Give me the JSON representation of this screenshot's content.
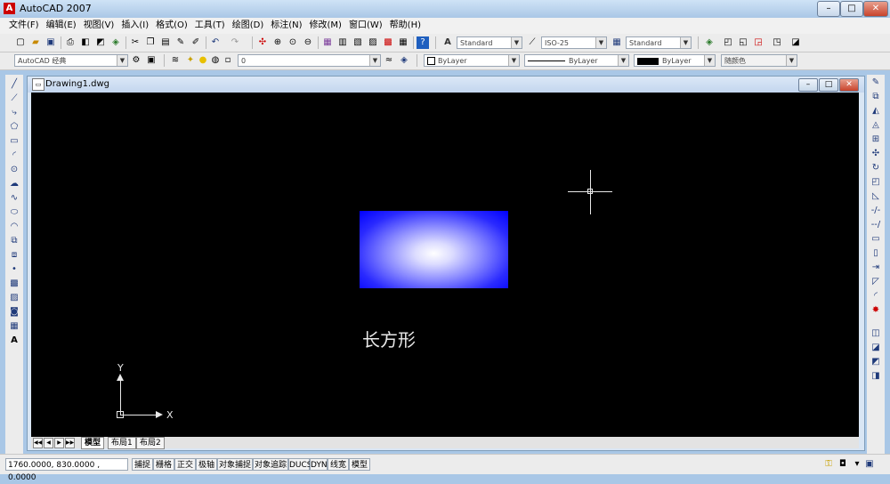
{
  "window": {
    "app_icon": "autocad-logo-icon",
    "title": "AutoCAD 2007",
    "min_label": "–",
    "max_label": "□",
    "close_label": "✕"
  },
  "menubar": [
    "文件(F)",
    "编辑(E)",
    "视图(V)",
    "插入(I)",
    "格式(O)",
    "工具(T)",
    "绘图(D)",
    "标注(N)",
    "修改(M)",
    "窗口(W)",
    "帮助(H)"
  ],
  "toolbar1": {
    "text_style": "Standard",
    "dim_style": "ISO-25",
    "table_style": "Standard"
  },
  "toolbar2": {
    "workspace": "AutoCAD 经典",
    "layer": "0",
    "color": "ByLayer",
    "linetype": "ByLayer",
    "lineweight": "ByLayer",
    "plot_style": "随颜色"
  },
  "drawing_window": {
    "title": "Drawing1.dwg",
    "min_label": "–",
    "max_label": "□",
    "close_label": "✕",
    "canvas_text": "长方形",
    "ucs": {
      "y_label": "Y",
      "x_label": "X"
    },
    "tab_nav": [
      "◀◀",
      "◀",
      "▶",
      "▶▶"
    ],
    "tabs": [
      "模型",
      "布局1",
      "布局2"
    ]
  },
  "statusbar": {
    "coordinates": "1760.0000, 830.0000 , 0.0000",
    "toggles": [
      "捕捉",
      "栅格",
      "正交",
      "极轴",
      "对象捕捉",
      "对象追踪",
      "DUCS",
      "DYN",
      "线宽",
      "模型"
    ]
  },
  "colors": {
    "canvas_bg": "#000000",
    "rect_fill_edge": "#0000ff",
    "rect_fill_center": "#ffffff"
  }
}
